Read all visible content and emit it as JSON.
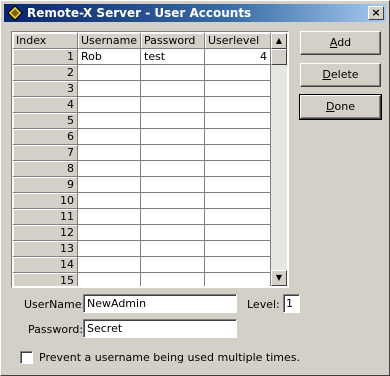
{
  "window": {
    "title": "Remote-X Server - User Accounts",
    "close_glyph": "×"
  },
  "grid": {
    "columns": [
      "Index",
      "Username",
      "Password",
      "Userlevel"
    ],
    "rows": [
      {
        "index": "1",
        "username": "Rob",
        "password": "test",
        "userlevel": "4"
      },
      {
        "index": "2",
        "username": "",
        "password": "",
        "userlevel": ""
      },
      {
        "index": "3",
        "username": "",
        "password": "",
        "userlevel": ""
      },
      {
        "index": "4",
        "username": "",
        "password": "",
        "userlevel": ""
      },
      {
        "index": "5",
        "username": "",
        "password": "",
        "userlevel": ""
      },
      {
        "index": "6",
        "username": "",
        "password": "",
        "userlevel": ""
      },
      {
        "index": "7",
        "username": "",
        "password": "",
        "userlevel": ""
      },
      {
        "index": "8",
        "username": "",
        "password": "",
        "userlevel": ""
      },
      {
        "index": "9",
        "username": "",
        "password": "",
        "userlevel": ""
      },
      {
        "index": "10",
        "username": "",
        "password": "",
        "userlevel": ""
      },
      {
        "index": "11",
        "username": "",
        "password": "",
        "userlevel": ""
      },
      {
        "index": "12",
        "username": "",
        "password": "",
        "userlevel": ""
      },
      {
        "index": "13",
        "username": "",
        "password": "",
        "userlevel": ""
      },
      {
        "index": "14",
        "username": "",
        "password": "",
        "userlevel": ""
      },
      {
        "index": "15",
        "username": "",
        "password": "",
        "userlevel": ""
      }
    ],
    "scroll_up_glyph": "▲",
    "scroll_down_glyph": "▼"
  },
  "buttons": {
    "add": "Add",
    "delete": "Delete",
    "done": "Done"
  },
  "form": {
    "username_label": "UserName:",
    "username_value": "NewAdmin",
    "level_label": "Level:",
    "level_value": "1",
    "password_label": "Password:",
    "password_value": "Secret",
    "checkbox_label": "Prevent a username being used multiple times."
  },
  "colors": {
    "titlebar_start": "#0a246a",
    "titlebar_end": "#a6caf0",
    "face": "#d4d0c8"
  }
}
